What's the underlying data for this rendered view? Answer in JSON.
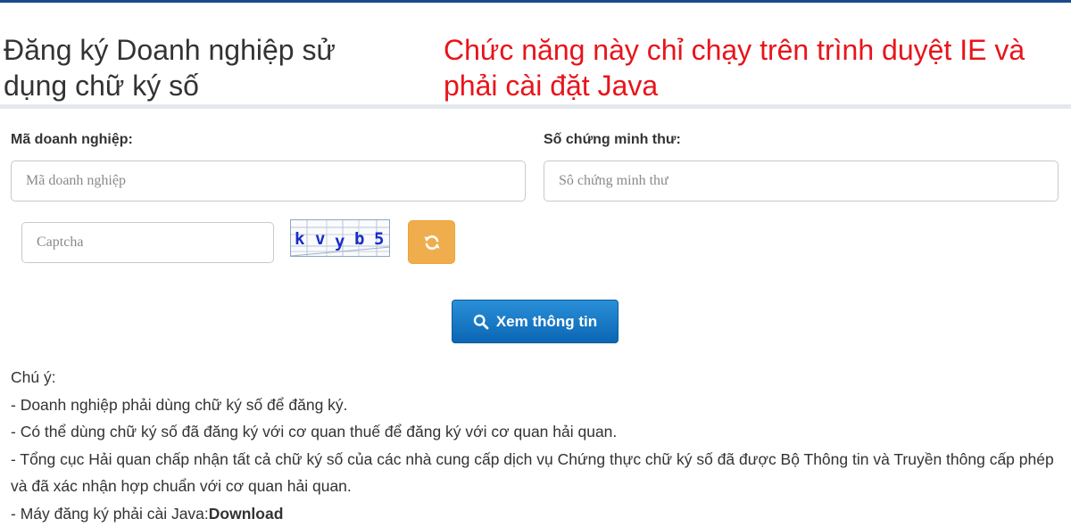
{
  "header": {
    "title": "Đăng ký Doanh nghiệp sử dụng chữ ký số",
    "warning": "Chức năng này chỉ chạy trên trình duyệt IE và phải cài đặt Java"
  },
  "form": {
    "business_code": {
      "label": "Mã doanh nghiệp:",
      "placeholder": "Mã doanh nghiệp",
      "value": ""
    },
    "id_number": {
      "label": "Số chứng minh thư:",
      "placeholder": "Sô chứng minh thư",
      "value": ""
    },
    "captcha": {
      "placeholder": "Captcha",
      "value": "",
      "image_chars": [
        "k",
        "v",
        "y",
        "b",
        "5"
      ]
    },
    "refresh_icon": "refresh-icon",
    "search_icon": "search-icon",
    "submit_label": "Xem thông tin"
  },
  "notes": {
    "heading": "Chú ý:",
    "items": [
      "- Doanh nghiệp phải dùng chữ ký số để đăng ký.",
      "- Có thể dùng chữ ký số đã đăng ký với cơ quan thuế để đăng ký với cơ quan hải quan.",
      "- Tổng cục Hải quan chấp nhận tất cả chữ ký số của các nhà cung cấp dịch vụ Chứng thực chữ ký số đã được Bộ Thông tin và Truyền thông cấp phép và đã xác nhận hợp chuẩn với cơ quan hải quan."
    ],
    "java_prefix": "- Máy đăng ký phải cài Java:",
    "download_label": "Download"
  },
  "colors": {
    "warning": "#e8141b",
    "primary": "#0b66b3",
    "refresh": "#f0ad4e",
    "captcha_text": "#1a2ec8"
  }
}
